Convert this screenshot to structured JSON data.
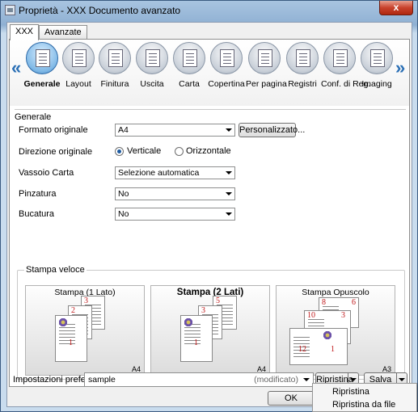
{
  "window": {
    "title": "Proprietà - XXX Documento avanzato",
    "close_label": "x"
  },
  "tabs": [
    "XXX",
    "Avanzate"
  ],
  "toolbar": {
    "items": [
      {
        "label": "Generale",
        "icon": "general-icon",
        "active": true
      },
      {
        "label": "Layout",
        "icon": "layout-icon"
      },
      {
        "label": "Finitura",
        "icon": "finishing-icon"
      },
      {
        "label": "Uscita",
        "icon": "output-icon"
      },
      {
        "label": "Carta",
        "icon": "paper-icon"
      },
      {
        "label": "Copertina",
        "icon": "cover-icon"
      },
      {
        "label": "Per pagina",
        "icon": "per-page-icon"
      },
      {
        "label": "Registri",
        "icon": "tabs-icon"
      },
      {
        "label": "Conf. di Reg.",
        "icon": "reg-settings-icon"
      },
      {
        "label": "Imaging",
        "icon": "imaging-icon"
      }
    ],
    "scroll_left": "«",
    "scroll_right": "»"
  },
  "general": {
    "group_title": "Generale",
    "original_size": {
      "label": "Formato originale",
      "value": "A4",
      "button": "Personalizzato..."
    },
    "orientation": {
      "label": "Direzione originale",
      "option_portrait": "Verticale",
      "option_landscape": "Orizzontale",
      "selected": "Verticale"
    },
    "paper_tray": {
      "label": "Vassoio Carta",
      "value": "Selezione automatica"
    },
    "stapling": {
      "label": "Pinzatura",
      "value": "No"
    },
    "punching": {
      "label": "Bucatura",
      "value": "No"
    }
  },
  "quick_print": {
    "title": "Stampa veloce",
    "cards": [
      {
        "title": "Stampa (1 Lato)",
        "size": "A4",
        "bold": false,
        "pages": [
          "3",
          "2",
          "1"
        ]
      },
      {
        "title": "Stampa (2 Lati)",
        "size": "A4",
        "bold": true,
        "pages": [
          "5",
          "3",
          "1"
        ]
      },
      {
        "title": "Stampa Opuscolo",
        "size": "A3",
        "bold": false,
        "pages": [
          "8",
          "6",
          "10",
          "3",
          "12",
          "1"
        ]
      }
    ]
  },
  "preferences": {
    "label": "Impostazioni preferite",
    "value": "sample",
    "modified": "(modificato)",
    "restore_button": "Ripristina",
    "save_button": "Salva"
  },
  "footer": {
    "ok_button": "OK"
  },
  "restore_menu": {
    "items": [
      "Ripristina",
      "Ripristina da file"
    ]
  }
}
